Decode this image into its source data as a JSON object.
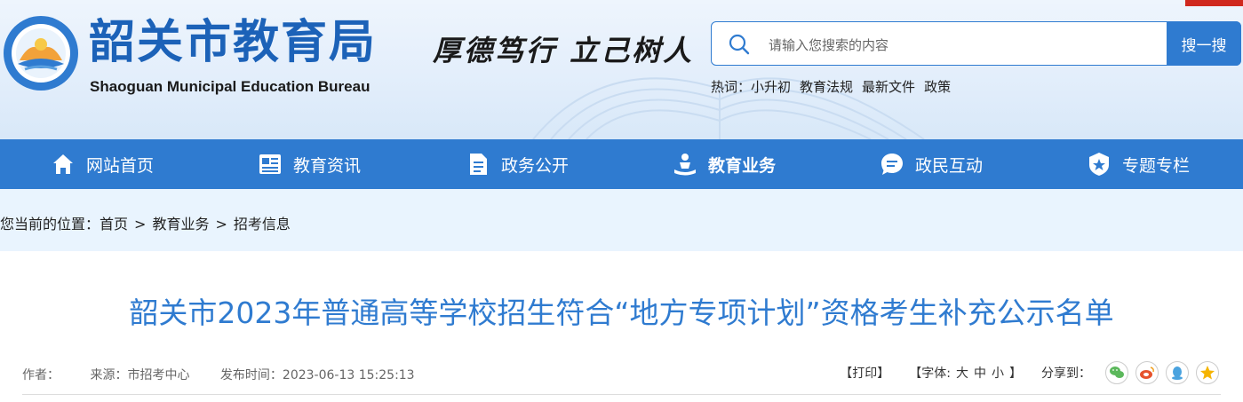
{
  "header": {
    "site_title": "韶关市教育局",
    "site_subtitle": "Shaoguan Municipal Education Bureau",
    "slogan": "厚德笃行  立己树人",
    "search": {
      "placeholder": "请输入您搜索的内容",
      "button_label": "搜一搜"
    },
    "hotwords": {
      "label": "热词：",
      "items": [
        "小升初",
        "教育法规",
        "最新文件",
        "政策"
      ]
    }
  },
  "nav": {
    "items": [
      {
        "label": "网站首页",
        "icon": "home-icon"
      },
      {
        "label": "教育资讯",
        "icon": "newspaper-icon"
      },
      {
        "label": "政务公开",
        "icon": "document-icon"
      },
      {
        "label": "教育业务",
        "icon": "education-icon",
        "active": true
      },
      {
        "label": "政民互动",
        "icon": "chat-icon"
      },
      {
        "label": "专题专栏",
        "icon": "badge-star-icon"
      }
    ]
  },
  "breadcrumb": {
    "prefix": "您当前的位置：",
    "items": [
      "首页",
      "教育业务",
      "招考信息"
    ],
    "separator": ">"
  },
  "article": {
    "title": "韶关市2023年普通高等学校招生符合“地方专项计划”资格考生补充公示名单",
    "author": "作者：",
    "source": "来源：市招考中心",
    "published": "发布时间：2023-06-13 15:25:13",
    "print": "【打印】",
    "font_label": "【字体:",
    "font_large": "大",
    "font_medium": "中",
    "font_small": "小",
    "font_close": "】",
    "share_label": "分享到：",
    "share_targets": [
      "wechat-icon",
      "weibo-icon",
      "qq-icon",
      "qzone-icon"
    ]
  },
  "colors": {
    "primary": "#2f7bd0",
    "title": "#2f7bd0",
    "accent_red": "#d0281e",
    "crumb_bg": "#e9f4fe"
  }
}
